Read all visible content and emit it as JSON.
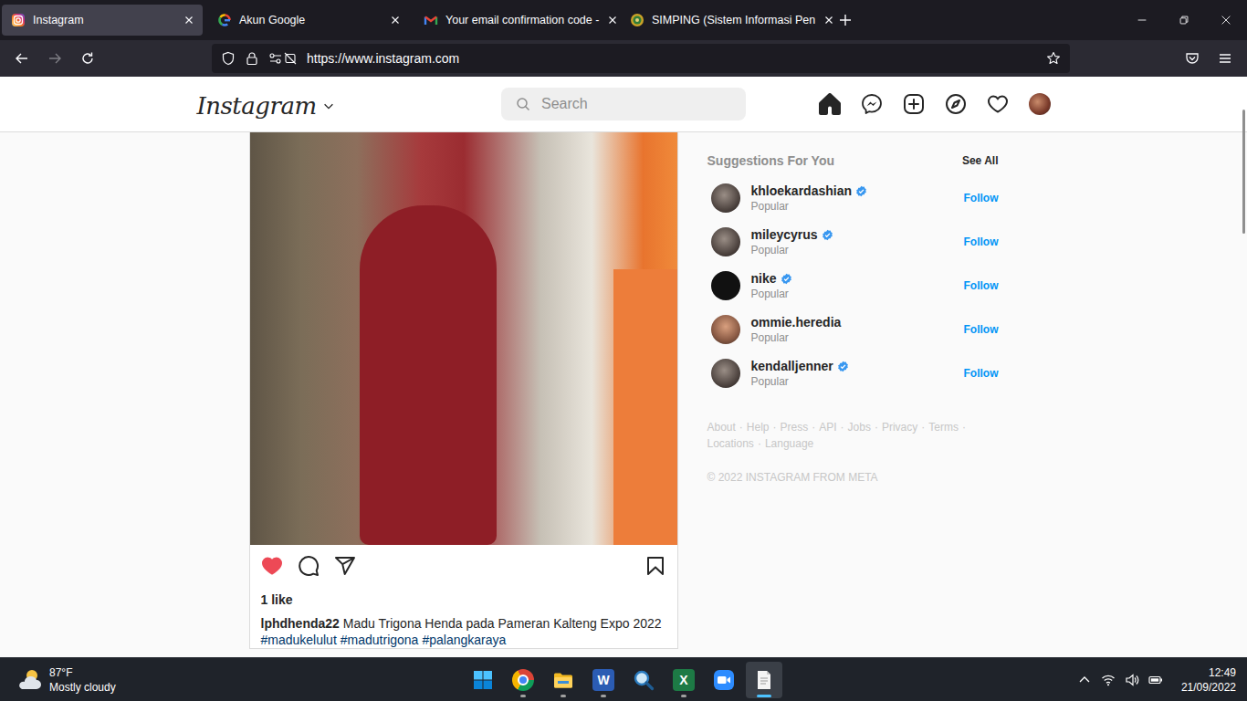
{
  "browser": {
    "tabs": [
      {
        "label": "Instagram",
        "selected": true,
        "favicon": "instagram"
      },
      {
        "label": "Akun Google",
        "selected": false,
        "favicon": "google"
      },
      {
        "label": "Your email confirmation code -",
        "selected": false,
        "favicon": "gmail"
      },
      {
        "label": "SIMPING (Sistem Informasi Pen",
        "selected": false,
        "favicon": "simping"
      }
    ],
    "address": "https://www.instagram.com",
    "forward_disabled": true,
    "bookmarked": false
  },
  "instagram": {
    "logo": "Instagram",
    "search": {
      "placeholder": "Search"
    },
    "nav": [
      {
        "kind": "home",
        "selected": true
      },
      {
        "kind": "messenger",
        "selected": false
      },
      {
        "kind": "create",
        "selected": false
      },
      {
        "kind": "explore",
        "selected": false
      },
      {
        "kind": "activity",
        "selected": false
      },
      {
        "kind": "profile",
        "selected": false
      }
    ],
    "post": {
      "liked": true,
      "saved": false,
      "likes": "1 like",
      "username": "lphdhenda22",
      "caption": "Madu Trigona Henda pada Pameran Kalteng Expo 2022",
      "hashtags": [
        "#madukelulut",
        "#madutrigona",
        "#palangkaraya"
      ]
    },
    "suggestions": {
      "title": "Suggestions For You",
      "see_all": "See All",
      "items": [
        {
          "username": "khloekardashian",
          "verified": true,
          "subtitle": "Popular",
          "action": "Follow"
        },
        {
          "username": "mileycyrus",
          "verified": true,
          "subtitle": "Popular",
          "action": "Follow"
        },
        {
          "username": "nike",
          "verified": true,
          "subtitle": "Popular",
          "action": "Follow"
        },
        {
          "username": "ommie.heredia",
          "verified": false,
          "subtitle": "Popular",
          "action": "Follow"
        },
        {
          "username": "kendalljenner",
          "verified": true,
          "subtitle": "Popular",
          "action": "Follow"
        }
      ]
    },
    "footer": {
      "links": [
        "About",
        "Help",
        "Press",
        "API",
        "Jobs",
        "Privacy",
        "Terms",
        "Locations",
        "Language"
      ],
      "separator": "·",
      "copyright": "© 2022 INSTAGRAM FROM META"
    }
  },
  "taskbar": {
    "weather": {
      "temperature": "87°F",
      "condition": "Mostly cloudy"
    },
    "apps": [
      {
        "kind": "start",
        "glyph": "",
        "running": false,
        "active": false
      },
      {
        "kind": "chrome",
        "glyph": "",
        "running": true,
        "active": false
      },
      {
        "kind": "explorer",
        "glyph": "",
        "running": true,
        "active": false
      },
      {
        "kind": "word",
        "glyph": "W",
        "running": true,
        "active": false
      },
      {
        "kind": "magnifier",
        "glyph": "",
        "running": false,
        "active": false
      },
      {
        "kind": "excel",
        "glyph": "X",
        "running": true,
        "active": false
      },
      {
        "kind": "zoom",
        "glyph": "",
        "running": false,
        "active": false
      },
      {
        "kind": "notepad",
        "glyph": "",
        "running": true,
        "active": true
      }
    ],
    "clock": {
      "time": "12:49",
      "date": "21/09/2022"
    }
  }
}
